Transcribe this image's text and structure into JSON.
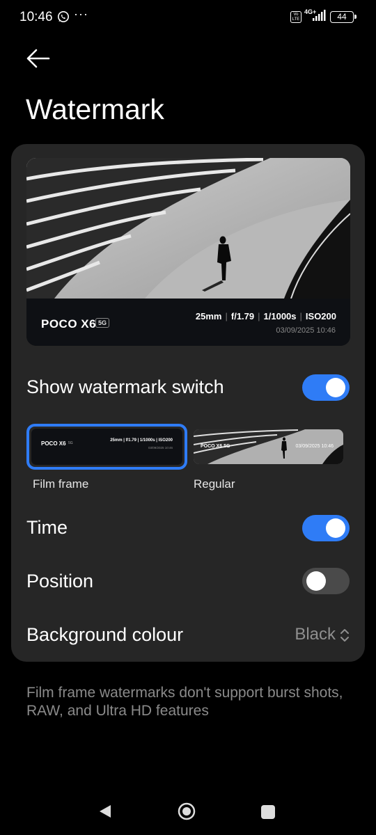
{
  "status_bar": {
    "time": "10:46",
    "volte": "Vo LTE",
    "network": "4G+",
    "battery": "44",
    "notification_icons": [
      "whatsapp-icon",
      "more-dots-icon"
    ]
  },
  "header": {
    "title": "Watermark"
  },
  "preview": {
    "brand": "POCO X6",
    "badge": "5G",
    "focal": "25mm",
    "aperture": "f/1.79",
    "shutter": "1/1000s",
    "iso": "ISO200",
    "datetime": "03/09/2025 10:46"
  },
  "settings": {
    "show_watermark": {
      "label": "Show watermark switch",
      "enabled": true
    },
    "styles": [
      {
        "label": "Film frame",
        "selected": true
      },
      {
        "label": "Regular",
        "selected": false
      }
    ],
    "regular_thumb_text": {
      "brand": "POCO X6 5G",
      "datetime": "03/09/2025 10:46"
    },
    "time": {
      "label": "Time",
      "enabled": true
    },
    "position": {
      "label": "Position",
      "enabled": false
    },
    "background_colour": {
      "label": "Background colour",
      "value": "Black"
    }
  },
  "footnote": "Film frame watermarks don't support burst shots, RAW, and Ultra HD features",
  "colors": {
    "accent": "#2f7cf6",
    "card": "#262626",
    "background": "#000000",
    "toggle_off": "#4a4a4a"
  }
}
